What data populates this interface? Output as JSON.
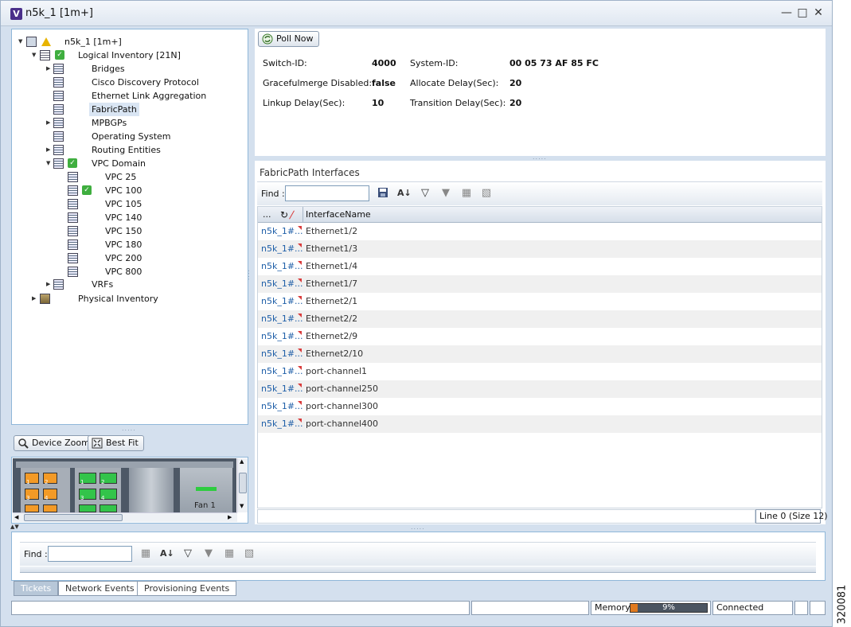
{
  "window": {
    "title": "n5k_1 [1m+]",
    "app_letter": "V"
  },
  "tree": {
    "root": "n5k_1 [1m+]",
    "logical": "Logical Inventory [21N]",
    "items": [
      "Bridges",
      "Cisco Discovery Protocol",
      "Ethernet Link Aggregation",
      "FabricPath",
      "MPBGPs",
      "Operating System",
      "Routing Entities",
      "VPC Domain"
    ],
    "vpc_children": [
      "VPC 25",
      "VPC 100",
      "VPC 105",
      "VPC 140",
      "VPC 150",
      "VPC 180",
      "VPC 200",
      "VPC 800"
    ],
    "vrfs": "VRFs",
    "physical": "Physical Inventory",
    "selected": "FabricPath"
  },
  "device_view": {
    "zoom_label": "Device Zoom",
    "bestfit_label": "Best Fit",
    "slot_numbers": [
      "1",
      "2",
      "3",
      "4"
    ],
    "fan_label": "Fan 1"
  },
  "toolbar": {
    "poll_label": "Poll Now"
  },
  "properties": {
    "rows": [
      {
        "k1": "Switch-ID:",
        "v1": "4000",
        "k2": "System-ID:",
        "v2": "00 05 73 AF 85 FC"
      },
      {
        "k1": "Gracefulmerge Disabled:",
        "v1": "false",
        "k2": "Allocate Delay(Sec):",
        "v2": "20"
      },
      {
        "k1": "Linkup Delay(Sec):",
        "v1": "10",
        "k2": "Transition Delay(Sec):",
        "v2": "20"
      }
    ]
  },
  "interfaces": {
    "title": "FabricPath Interfaces",
    "find_label": "Find :",
    "col_more": "...",
    "col_name": "InterfaceName",
    "link_text": "n5k_1#...",
    "rows": [
      "Ethernet1/2",
      "Ethernet1/3",
      "Ethernet1/4",
      "Ethernet1/7",
      "Ethernet2/1",
      "Ethernet2/2",
      "Ethernet2/9",
      "Ethernet2/10",
      "port-channel1",
      "port-channel250",
      "port-channel300",
      "port-channel400"
    ],
    "status": "Line 0 (Size 12)"
  },
  "bottom": {
    "find_label": "Find :",
    "tabs": [
      "Tickets",
      "Network Events",
      "Provisioning Events"
    ],
    "active_tab": "Tickets"
  },
  "statusbar": {
    "memory_label": "Memory:",
    "memory_value": "9%",
    "memory_fraction": 0.09,
    "connection": "Connected"
  },
  "side_number": "320081",
  "colors": {
    "accent": "#8fb7d9",
    "link": "#1f5fa8",
    "memory_fill": "#e07a1f"
  }
}
